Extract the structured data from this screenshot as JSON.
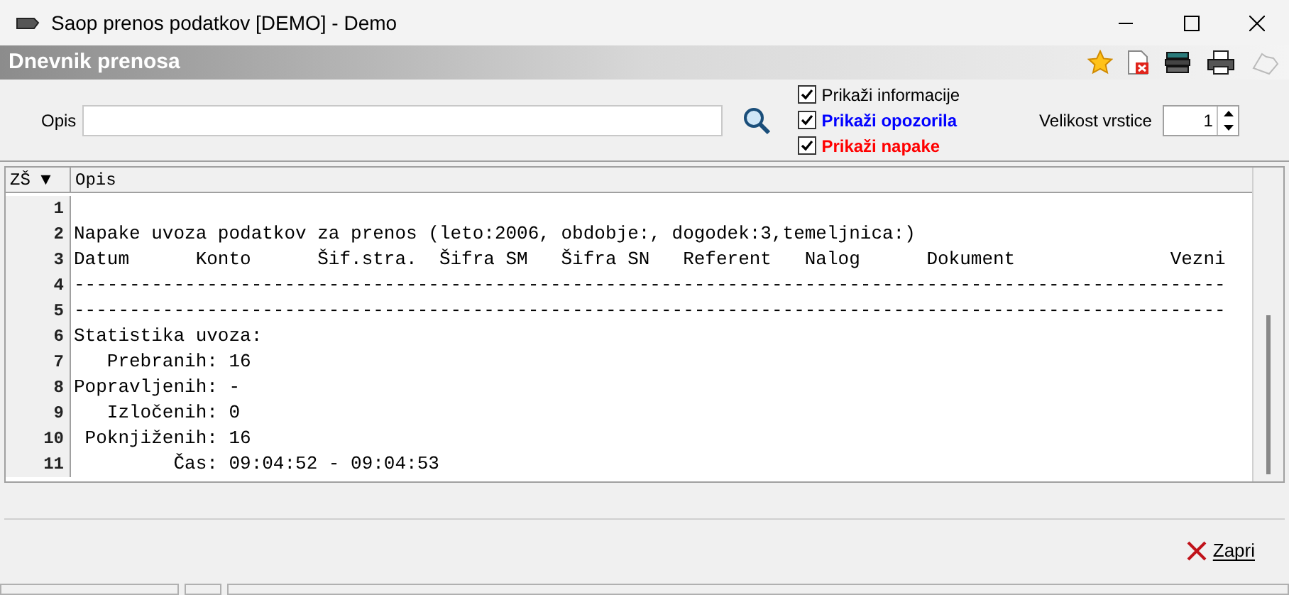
{
  "window": {
    "title": "Saop prenos podatkov [DEMO] - Demo"
  },
  "panel": {
    "title": "Dnevnik prenosa"
  },
  "filter": {
    "label": "Opis",
    "options": [
      {
        "label": "Prikaži informacije",
        "checked": true,
        "color": "#000000"
      },
      {
        "label": "Prikaži opozorila",
        "checked": true,
        "color": "#0000ff"
      },
      {
        "label": "Prikaži napake",
        "checked": true,
        "color": "#ff0000"
      }
    ],
    "row_size": {
      "label": "Velikost vrstice",
      "value": "1"
    }
  },
  "table": {
    "columns": [
      "ZŠ ▼",
      "Opis"
    ],
    "rows": [
      {
        "number": "1",
        "text": ""
      },
      {
        "number": "2",
        "text": "Napake uvoza podatkov za prenos (leto:2006, obdobje:, dogodek:3,temeljnica:)"
      },
      {
        "number": "3",
        "text": "Datum      Konto      Šif.stra.  Šifra SM   Šifra SN   Referent   Nalog      Dokument              Vezni"
      },
      {
        "number": "4",
        "text": "--------------------------------------------------------------------------------------------------------"
      },
      {
        "number": "5",
        "text": "--------------------------------------------------------------------------------------------------------"
      },
      {
        "number": "6",
        "text": "Statistika uvoza:"
      },
      {
        "number": "7",
        "text": "   Prebranih: 16"
      },
      {
        "number": "8",
        "text": "Popravljenih: -"
      },
      {
        "number": "9",
        "text": "   Izločenih: 0"
      },
      {
        "number": "10",
        "text": " Poknjiženih: 16"
      },
      {
        "number": "11",
        "text": "         Čas: 09:04:52 - 09:04:53"
      }
    ]
  },
  "buttons": [
    {
      "label": "Zapri"
    }
  ]
}
